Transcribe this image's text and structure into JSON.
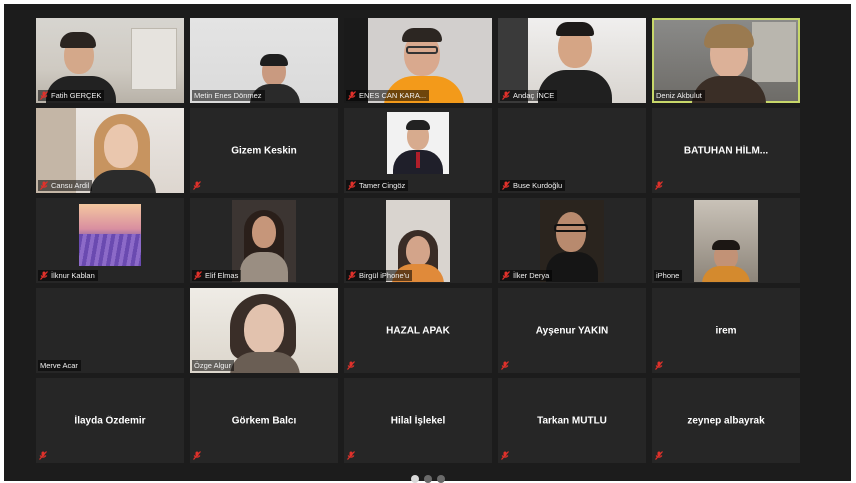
{
  "participants": [
    {
      "name": "Fatih GERÇEK",
      "video": true,
      "muted": true
    },
    {
      "name": "Metin Enes Dönmez",
      "video": true,
      "muted": false
    },
    {
      "name": "ENES CAN KARA...",
      "video": true,
      "muted": true
    },
    {
      "name": "Andaç İNCE",
      "video": true,
      "muted": true
    },
    {
      "name": "Deniz Akbulut",
      "video": true,
      "muted": false,
      "speaking": true
    },
    {
      "name": "Cansu Ardil",
      "video": true,
      "muted": true
    },
    {
      "name": "Gizem Keskin",
      "video": false,
      "muted": true
    },
    {
      "name": "Tamer Cingöz",
      "video": true,
      "muted": true
    },
    {
      "name": "Buse Kurdoğlu",
      "video": false,
      "muted": true
    },
    {
      "name": "BATUHAN HİLM...",
      "video": false,
      "muted": true
    },
    {
      "name": "İlknur Kablan",
      "video": true,
      "muted": true
    },
    {
      "name": "Elif Elmas",
      "video": true,
      "muted": true
    },
    {
      "name": "Birgül iPhone'u",
      "video": true,
      "muted": true
    },
    {
      "name": "İlker Derya",
      "video": true,
      "muted": true
    },
    {
      "name": "iPhone",
      "video": true,
      "muted": false
    },
    {
      "name": "Merve Acar",
      "video": false,
      "muted": false
    },
    {
      "name": "Özge Algur",
      "video": true,
      "muted": false
    },
    {
      "name": "HAZAL APAK",
      "video": false,
      "muted": true
    },
    {
      "name": "Ayşenur YAKIN",
      "video": false,
      "muted": true
    },
    {
      "name": "irem",
      "video": false,
      "muted": true
    },
    {
      "name": "İlayda Özdemir",
      "video": false,
      "muted": true
    },
    {
      "name": "Görkem Balcı",
      "video": false,
      "muted": true
    },
    {
      "name": "Hilal İşlekel",
      "video": false,
      "muted": true
    },
    {
      "name": "Tarkan MUTLU",
      "video": false,
      "muted": true
    },
    {
      "name": "zeynep albayrak",
      "video": false,
      "muted": true
    }
  ],
  "pagination": {
    "pages": 3,
    "current": 1
  },
  "colors": {
    "background": "#1c1c1c",
    "tile": "#262626",
    "speaking_border": "#c8d86a",
    "mute_icon": "#e0312b"
  },
  "icons": {
    "mute": "mic-muted-icon"
  }
}
